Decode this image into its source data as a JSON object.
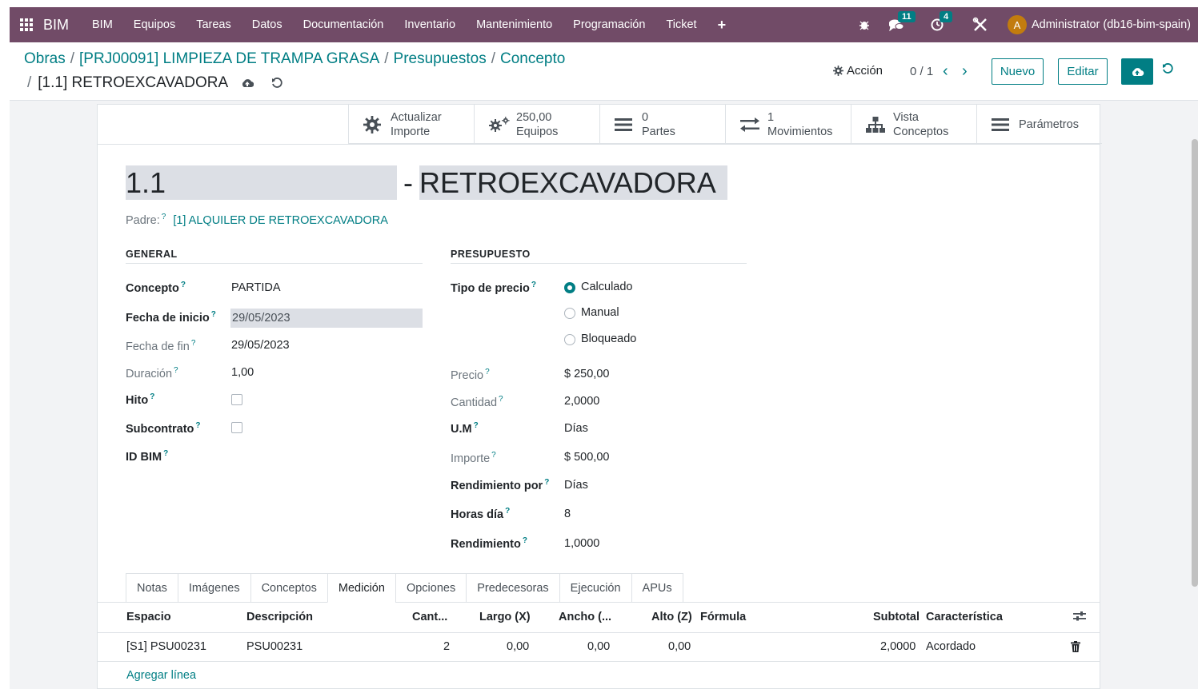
{
  "navbar": {
    "brand": "BIM",
    "menu": [
      "BIM",
      "Equipos",
      "Tareas",
      "Datos",
      "Documentación",
      "Inventario",
      "Mantenimiento",
      "Programación",
      "Ticket",
      "+"
    ],
    "messages_count": "11",
    "activities_count": "4",
    "avatar_letter": "A",
    "user": "Administrator (db16-bim-spain)",
    "bg_color": "#714b67"
  },
  "control": {
    "breadcrumb": [
      "Obras",
      "[PRJ00091] LIMPIEZA DE TRAMPA GRASA",
      "Presupuestos",
      "Concepto"
    ],
    "current": "[1.1] RETROEXCAVADORA",
    "action_label": "Acción",
    "pager": "0 / 1",
    "new_label": "Nuevo",
    "edit_label": "Editar",
    "accent_color": "#017e84"
  },
  "stat_buttons": [
    {
      "icon": "gear-icon",
      "line1": "Actualizar",
      "line2": "Importe"
    },
    {
      "icon": "gears-icon",
      "line1": "250,00",
      "line2": "Equipos"
    },
    {
      "icon": "bars-icon",
      "line1": "0",
      "line2": "Partes"
    },
    {
      "icon": "exchange-icon",
      "line1": "1",
      "line2": "Movimientos"
    },
    {
      "icon": "sitemap-icon",
      "line1": "Vista",
      "line2": "Conceptos"
    },
    {
      "icon": "bars-icon",
      "line1": "Parámetros",
      "line2": ""
    }
  ],
  "record": {
    "code": "1.1",
    "name": "RETROEXCAVADORA",
    "parent_label": "Padre:",
    "parent_value": "[1] ALQUILER DE RETROEXCAVADORA"
  },
  "general": {
    "title": "GENERAL",
    "concepto_label": "Concepto",
    "concepto_value": "PARTIDA",
    "fecha_inicio_label": "Fecha de inicio",
    "fecha_inicio_value": "29/05/2023",
    "fecha_fin_label": "Fecha de fin",
    "fecha_fin_value": "29/05/2023",
    "duracion_label": "Duración",
    "duracion_value": "1,00",
    "hito_label": "Hito",
    "subcontrato_label": "Subcontrato",
    "id_bim_label": "ID BIM"
  },
  "presupuesto": {
    "title": "PRESUPUESTO",
    "tipo_precio_label": "Tipo de precio",
    "tipo_precio_options": [
      "Calculado",
      "Manual",
      "Bloqueado"
    ],
    "tipo_precio_selected": "Calculado",
    "precio_label": "Precio",
    "precio_value": "$ 250,00",
    "cantidad_label": "Cantidad",
    "cantidad_value": "2,0000",
    "um_label": "U.M",
    "um_value": "Días",
    "importe_label": "Importe",
    "importe_value": "$ 500,00",
    "rendimiento_por_label": "Rendimiento por",
    "rendimiento_por_value": "Días",
    "horas_dia_label": "Horas día",
    "horas_dia_value": "8",
    "rendimiento_label": "Rendimiento",
    "rendimiento_value": "1,0000"
  },
  "help_mark": "?",
  "tabs": [
    "Notas",
    "Imágenes",
    "Conceptos",
    "Medición",
    "Opciones",
    "Predecesoras",
    "Ejecución",
    "APUs"
  ],
  "active_tab": "Medición",
  "table": {
    "headers": {
      "espacio": "Espacio",
      "descripcion": "Descripción",
      "cantidad": "Cant...",
      "largo": "Largo (X)",
      "ancho": "Ancho (...",
      "alto": "Alto (Z)",
      "formula": "Fórmula",
      "subtotal": "Subtotal",
      "caracteristica": "Característica"
    },
    "rows": [
      {
        "espacio": "[S1] PSU00231",
        "descripcion": "PSU00231",
        "cantidad": "2",
        "largo": "0,00",
        "ancho": "0,00",
        "alto": "0,00",
        "formula": "",
        "subtotal": "2,0000",
        "caracteristica": "Acordado"
      }
    ],
    "add_line": "Agregar línea"
  }
}
